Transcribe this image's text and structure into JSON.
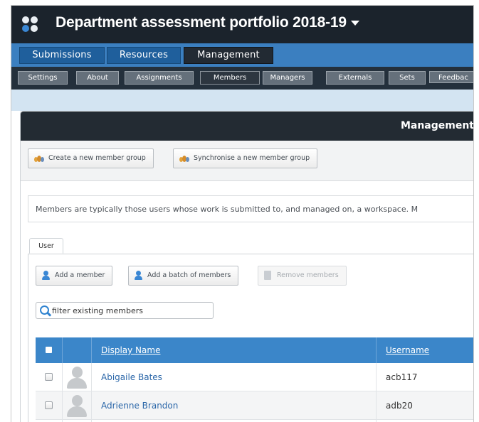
{
  "app": {
    "title": "Department assessment portfolio 2018-19",
    "colors": {
      "header": "#1b232c",
      "primary_nav": "#3b7fc0",
      "accent": "#3b86c9",
      "link": "#2a66a8"
    }
  },
  "primary_nav": {
    "tabs": [
      {
        "label": "Submissions",
        "active": false
      },
      {
        "label": "Resources",
        "active": false
      },
      {
        "label": "Management",
        "active": true
      }
    ]
  },
  "secondary_nav": {
    "items": [
      {
        "label": "Settings",
        "active": false
      },
      {
        "label": "About",
        "active": false
      },
      {
        "label": "Assignments",
        "active": false
      },
      {
        "label": "Members",
        "active": true
      },
      {
        "label": "Managers",
        "active": false
      },
      {
        "label": "Externals",
        "active": false
      },
      {
        "label": "Sets",
        "active": false
      },
      {
        "label": "Feedbac",
        "active": false
      }
    ]
  },
  "panel": {
    "title": "Management",
    "group_buttons": {
      "create": "Create a new member group",
      "sync": "Synchronise a new member group"
    },
    "info_text": "Members are typically those users whose work is submitted to, and managed on, a workspace. M",
    "tabs": [
      {
        "label": "User",
        "active": true
      }
    ],
    "actions": {
      "add_member": "Add a member",
      "add_batch": "Add a batch of members",
      "remove": "Remove members"
    },
    "filter": {
      "placeholder": "filter existing members",
      "value": ""
    },
    "table": {
      "columns": {
        "display_name": "Display Name",
        "username": "Username"
      },
      "rows": [
        {
          "display_name": "Abigaile Bates",
          "username": "acb117"
        },
        {
          "display_name": "Adrienne Brandon",
          "username": "adb20"
        }
      ]
    }
  }
}
